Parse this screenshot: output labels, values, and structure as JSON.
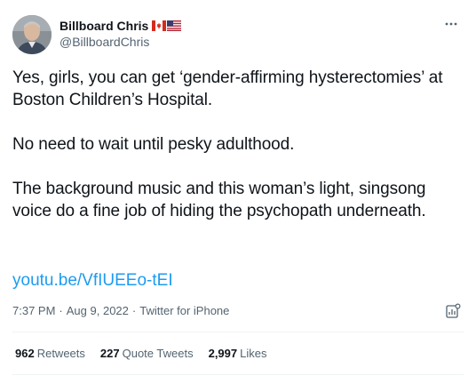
{
  "author": {
    "display_name": "Billboard Chris",
    "flags": [
      "canada-flag",
      "usa-flag"
    ],
    "handle": "@BillboardChris",
    "avatar_icon": "profile-photo"
  },
  "tweet": {
    "paragraphs": [
      "Yes, girls, you can get ‘gender-affirming hysterectomies’ at Boston Children’s Hospital.",
      "No need to wait until pesky adulthood.",
      "The background music and this woman’s light, singsong voice do a fine job of hiding the psychopath underneath."
    ],
    "link": "youtu.be/VfIUEEo-tEI"
  },
  "meta": {
    "time": "7:37 PM",
    "date": "Aug 9, 2022",
    "source": "Twitter for iPhone",
    "separator": "·"
  },
  "stats": [
    {
      "value": "962",
      "label": "Retweets"
    },
    {
      "value": "227",
      "label": "Quote Tweets"
    },
    {
      "value": "2,997",
      "label": "Likes"
    }
  ],
  "colors": {
    "text": "#0f1419",
    "secondary": "#536471",
    "link": "#1d9bf0",
    "divider": "#eff3f4"
  }
}
